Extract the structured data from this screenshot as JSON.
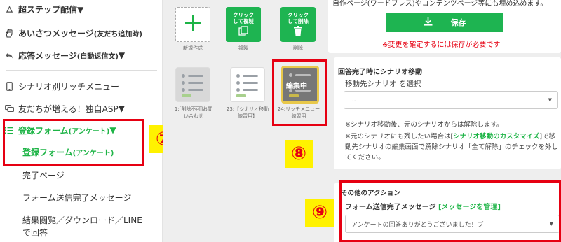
{
  "sidebar": {
    "item_top": "超ステップ配信▼",
    "greeting": {
      "label": "あいさつメッセージ",
      "sub": "(友だち追加時)"
    },
    "reply": {
      "label": "応答メッセージ",
      "sub": "(自動返信文)",
      "caret": "▼"
    },
    "rich_menu": "シナリオ別リッチメニュー",
    "asp": "友だちが増える！独自ASP",
    "asp_caret": "▼",
    "form_parent": {
      "label": "登録フォーム",
      "sub": "(アンケート)",
      "caret": "▼"
    },
    "form_child": {
      "label": "登録フォーム",
      "sub": "(アンケート)"
    },
    "complete_page": "完了ページ",
    "form_sent_msg": "フォーム送信完了メッセージ",
    "results_line1": "結果閲覧／ダウンロード／LINE",
    "results_line2": "で回答"
  },
  "markers": {
    "m7": "⑦",
    "m8": "⑧",
    "m9": "⑨"
  },
  "middle": {
    "new_label": "新規作成",
    "copy_btn": "クリック\nして複製",
    "copy_label": "複製",
    "delete_btn": "クリック\nして削除",
    "delete_label": "削除",
    "scenario1_label": "1:[削除不可]お問い合わせ",
    "scenario2_label": "23:【シナリオ移動練習用】",
    "scenario3_label": "24:リッチメニュー練習用",
    "editing_badge": "編集中"
  },
  "right": {
    "top_note": "自作ページ(ワードプレス)やコンテンツページ等にも埋め込めます。",
    "save_label": "保存",
    "save_warning": "※変更を確定するには保存が必要です",
    "move_title": "回答完了時にシナリオ移動",
    "move_select_label": "移動先シナリオ を選択",
    "move_select_value": "...",
    "note1": "※シナリオ移動後、元のシナリオからは解除します。",
    "note2_a": "※元のシナリオにも残したい場合は[",
    "note2_link": "シナリオ移動のカスタマイズ",
    "note2_b": "]で移動先シナリオの編集画面で解除シナリオ「全て解除」のチェックを外してください。",
    "other_title": "その他のアクション",
    "form_msg_label": "フォーム送信完了メッセージ",
    "form_msg_link": "[メッセージを管理]",
    "form_msg_value": "アンケートの回答ありがとうございました！ブ"
  },
  "colors": {
    "accent": "#1db446",
    "highlight": "#e60012",
    "marker_bg": "#fff200"
  }
}
